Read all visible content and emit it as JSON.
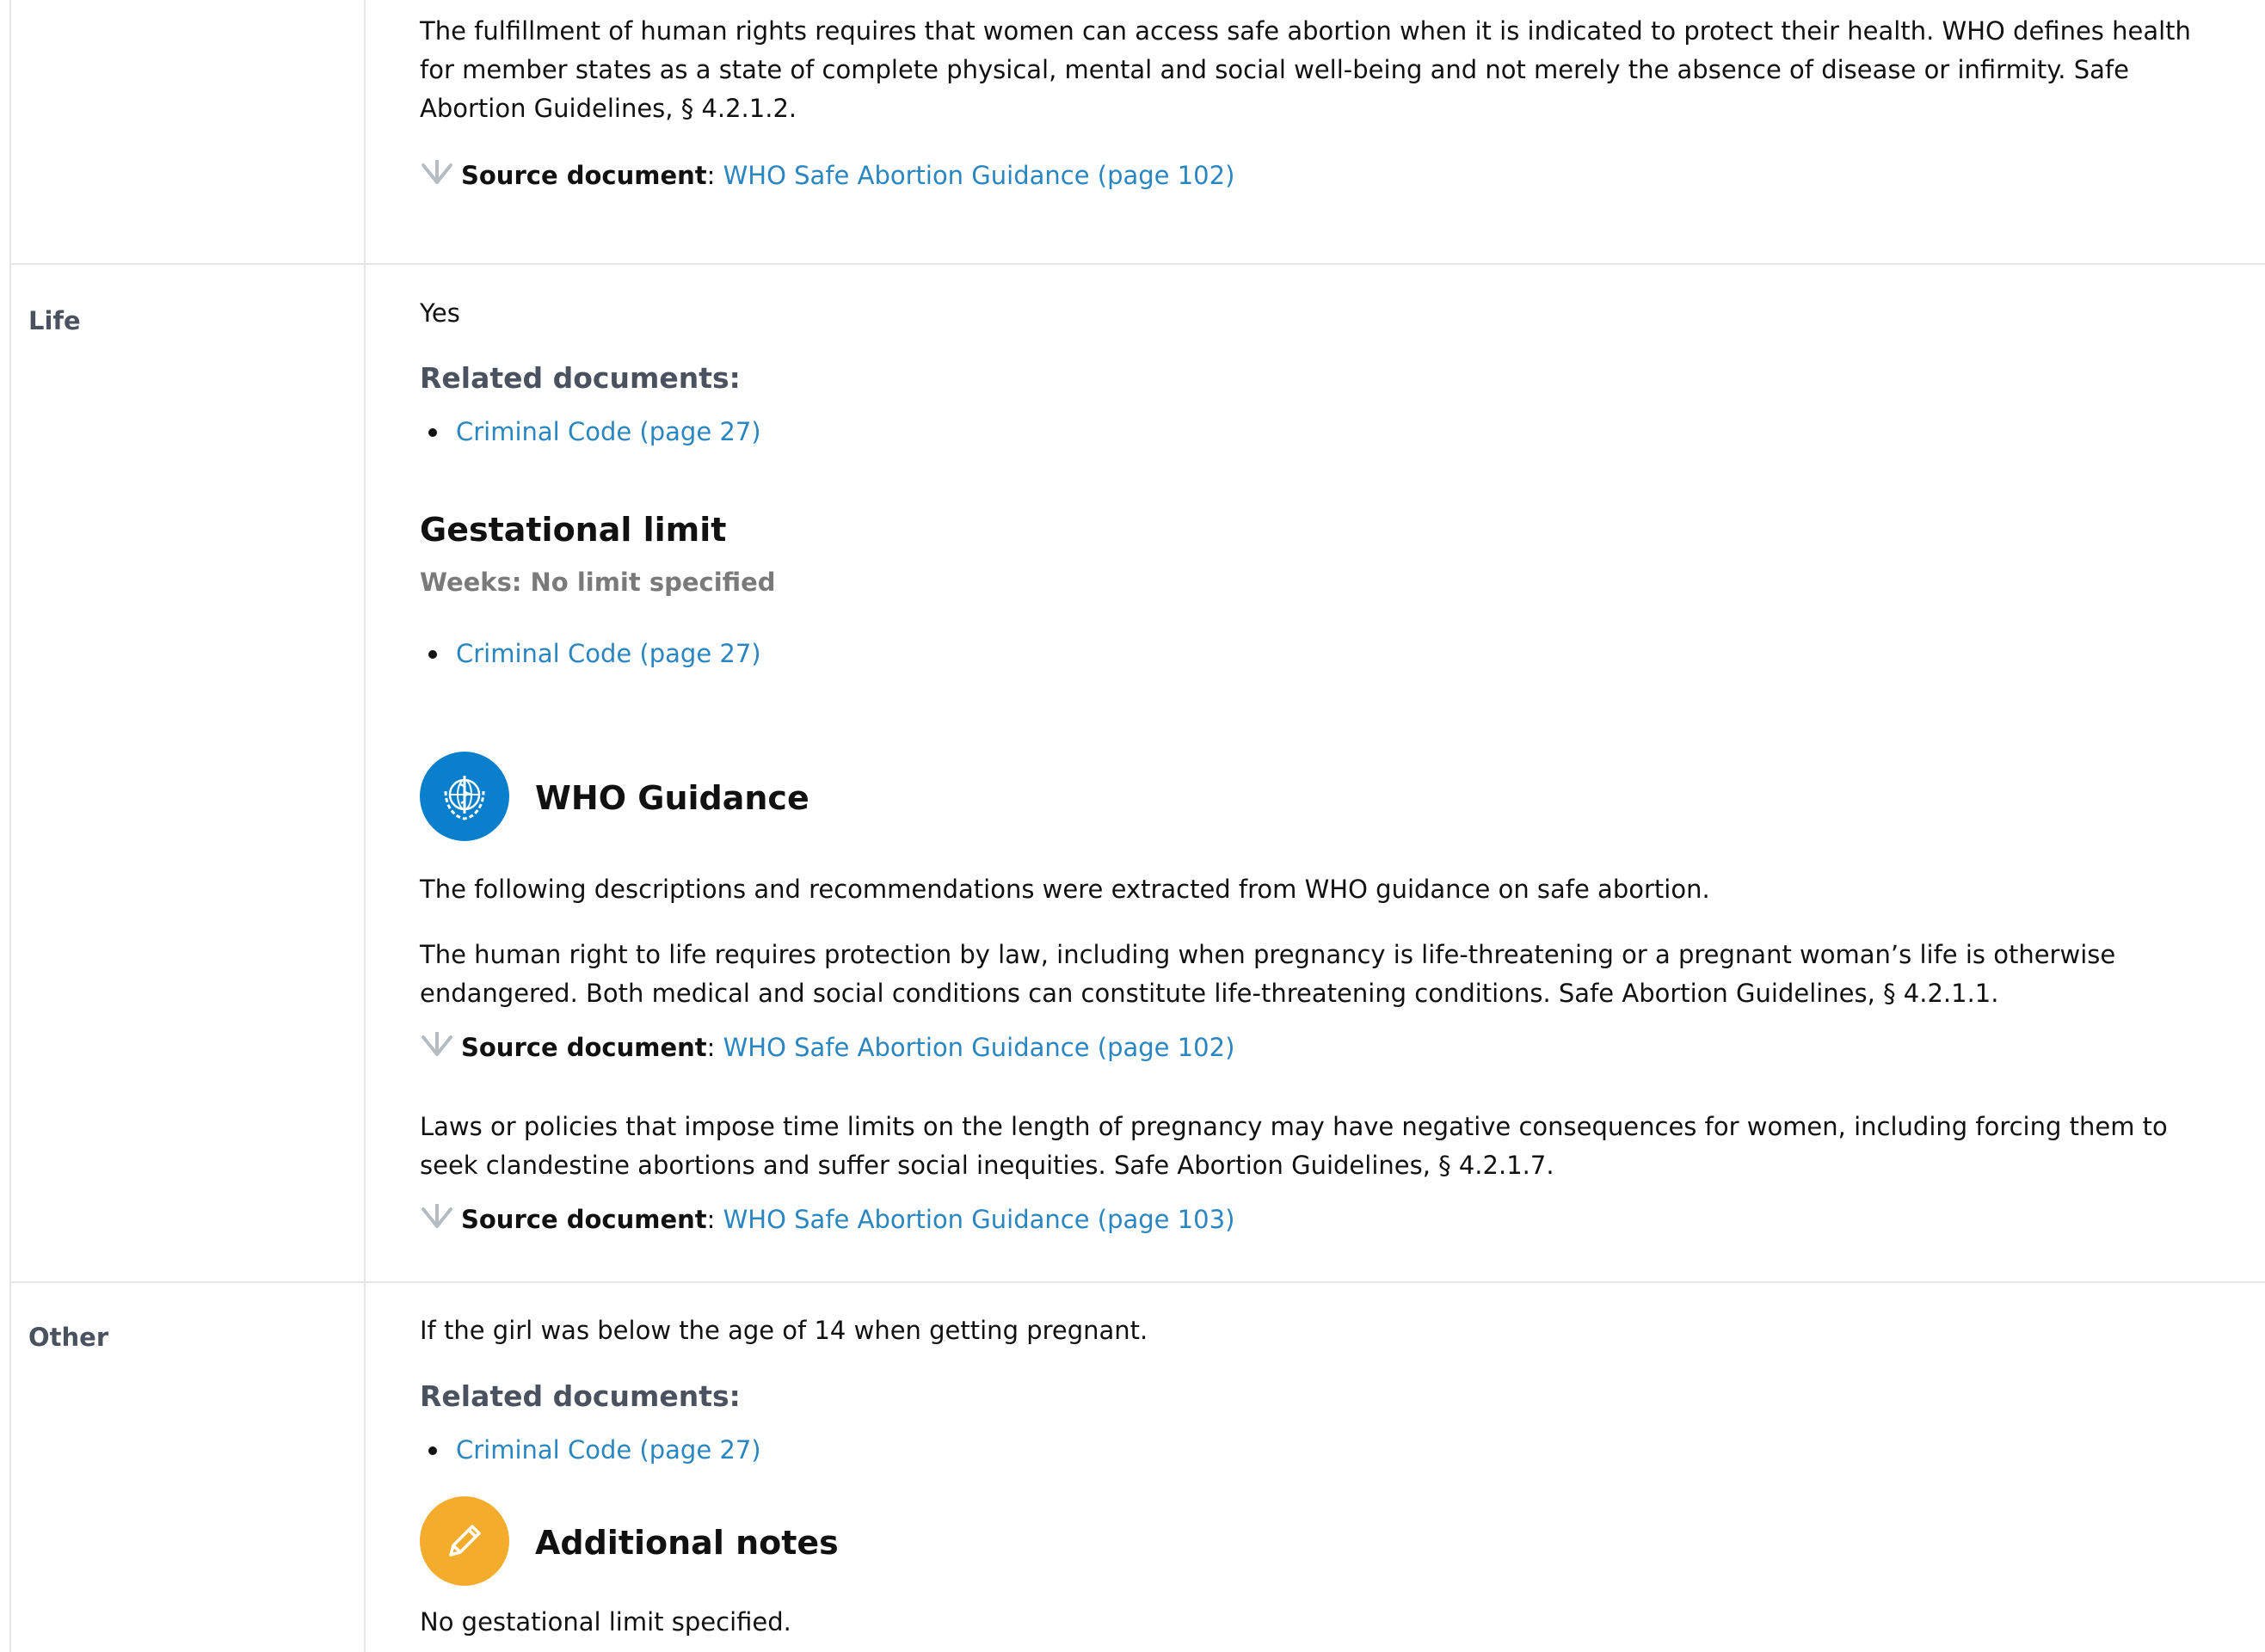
{
  "colors": {
    "link": "#2a86c0",
    "label": "#4a5260",
    "who_badge": "#0a7fcc",
    "note_badge": "#f3ac2c",
    "border": "#e6e6e6"
  },
  "top_section": {
    "paragraph": "The fulfillment of human rights requires that women can access safe abortion when it is indicated to protect their health. WHO defines health for member states as a state of complete physical, mental and social well-being and not merely the absence of disease or infirmity. Safe Abortion Guidelines, § 4.2.1.2.",
    "source": {
      "label": "Source document",
      "link": "WHO Safe Abortion Guidance (page 102)",
      "icon": "download-arrow-icon"
    }
  },
  "life": {
    "label": "Life",
    "answer": "Yes",
    "related_heading": "Related documents:",
    "related_documents": [
      "Criminal Code (page 27)"
    ],
    "gestational": {
      "heading": "Gestational limit",
      "weeks": "Weeks: No limit specified",
      "documents": [
        "Criminal Code (page 27)"
      ]
    },
    "who_guidance": {
      "icon": "who-emblem-icon",
      "title": "WHO Guidance",
      "intro": "The following descriptions and recommendations were extracted from WHO guidance on safe abortion.",
      "items": [
        {
          "text": "The human right to life requires protection by law, including when pregnancy is life-threatening or a pregnant woman’s life is otherwise endangered. Both medical and social conditions can constitute life-threatening conditions. Safe Abortion Guidelines, § 4.2.1.1.",
          "source_label": "Source document",
          "source_link": "WHO Safe Abortion Guidance (page 102)"
        },
        {
          "text": "Laws or policies that impose time limits on the length of pregnancy may have negative consequences for women, including forcing them to seek clandestine abortions and suffer social inequities. Safe Abortion Guidelines, § 4.2.1.7.",
          "source_label": "Source document",
          "source_link": "WHO Safe Abortion Guidance (page 103)"
        }
      ]
    }
  },
  "other": {
    "label": "Other",
    "answer": "If the girl was below the age of 14 when getting pregnant.",
    "related_heading": "Related documents:",
    "related_documents": [
      "Criminal Code (page 27)"
    ],
    "notes": {
      "icon": "pencil-icon",
      "title": "Additional notes",
      "text": "No gestational limit specified."
    }
  }
}
